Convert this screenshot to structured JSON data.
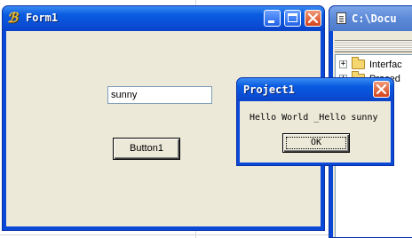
{
  "form1": {
    "title": "Form1",
    "app_icon": "vb-project-icon",
    "textbox_value": "sunny",
    "button_label": "Button1"
  },
  "explorer": {
    "title": "C:\\Docu",
    "tree": [
      {
        "label": "Interfac",
        "icon": "folder-icon",
        "expander": "+"
      },
      {
        "label": "Proced",
        "icon": "folder-icon",
        "expander": "+"
      }
    ]
  },
  "msgbox": {
    "title": "Project1",
    "message": "Hello World _Hello sunny",
    "ok_label": "OK"
  },
  "colors": {
    "titlebar_blue": "#0a4fd6",
    "window_face": "#ece9d8",
    "close_red": "#d5421a"
  }
}
